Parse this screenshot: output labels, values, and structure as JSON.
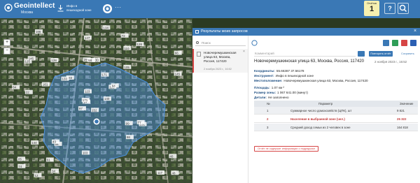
{
  "header": {
    "logo_text": "Geointellect",
    "logo_city": "Москва",
    "instrument_label": "Инфо в пешеходной зоне",
    "more_label": "···",
    "queries_label": "Отчётов",
    "queries_count": "1",
    "help_label": "?",
    "search_icon": "search-icon"
  },
  "map": {
    "zoom_in": "+",
    "zoom_out": "−",
    "buildings": [
      "152",
      "125",
      "14",
      "85",
      "115",
      "56",
      "72",
      "130",
      "110",
      "140",
      "186",
      "48",
      "22",
      "66",
      "97",
      "105",
      "12",
      "29",
      "171",
      "144",
      "183",
      "74",
      "61",
      "58",
      "94",
      "131",
      "145",
      "147",
      "84",
      "99",
      "145",
      "171",
      "103",
      "123",
      "128",
      "126",
      "43",
      "117",
      "40",
      "77",
      "134",
      "133",
      "161",
      "98",
      "34"
    ]
  },
  "panel": {
    "title": "Результаты моих запросов",
    "close": "×",
    "search_placeholder": "Поиск",
    "list_item": {
      "text": "Новочеремушкинская улица 63, Москва, Россия, 117420",
      "date": "2 ноября 2023 г., 16:52",
      "close": "×"
    },
    "detail": {
      "comment_placeholder": "Комментарий",
      "repeat_button": "Повторить отчёт",
      "save_link": "Сохранить",
      "address": "Новочеремушкинская улица 63, Москва, Россия, 117420",
      "date": "2 ноября 2023 г., 16:52",
      "coordinates_label": "Координаты:",
      "coordinates_value": "55.66387 37.56178",
      "instrument_label": "Инструмент:",
      "instrument_value": "Инфо в пешеходной зоне",
      "location_label": "Местоположение:",
      "location_value": "Новочеремушкинская улица 63, Москва, Россия, 117420",
      "area_label": "Площадь:",
      "area_value": "1.07 км ²",
      "zone_label": "Размер зоны:",
      "zone_value": "1 067 641.00 (минут)",
      "details_label": "Детали:",
      "details_value": "Не заполнено",
      "table": {
        "headers": [
          "№",
          "Параметр",
          "Значение"
        ],
        "rows": [
          {
            "n": "1",
            "param": "Суммарное число домохозяйств (ЦПК), шт",
            "value": "9 821"
          },
          {
            "n": "2",
            "param": "Население в выбранной зоне (чел.)",
            "value": "25 322"
          },
          {
            "n": "3",
            "param": "Средний доход семьи из 2 человек в зоне",
            "value": "164 818"
          }
        ]
      },
      "error_button": "Отчёт не содержит информации о подрядчике"
    }
  }
}
